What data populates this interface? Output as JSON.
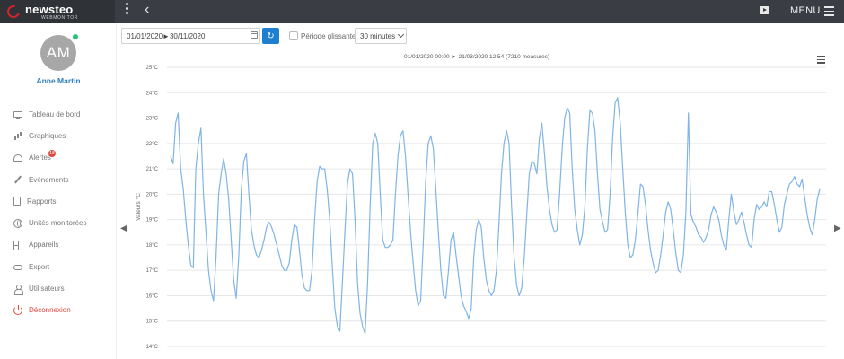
{
  "topbar": {
    "logo_main": "newsteo",
    "logo_sub": "WEBMONITOR",
    "menu_label": "MENU"
  },
  "user": {
    "initials": "AM",
    "name": "Anne Martin",
    "status_color": "#27c27a"
  },
  "sidebar": {
    "items": [
      {
        "label": "Tableau de bord",
        "icon": "monitor-icon"
      },
      {
        "label": "Graphiques",
        "icon": "bar-chart-icon"
      },
      {
        "label": "Alertes",
        "icon": "bell-icon",
        "badge": "18"
      },
      {
        "label": "Evénements",
        "icon": "pen-icon"
      },
      {
        "label": "Rapports",
        "icon": "document-icon"
      },
      {
        "label": "Unités monitorées",
        "icon": "globe-icon"
      },
      {
        "label": "Appareils",
        "icon": "grid-icon"
      },
      {
        "label": "Export",
        "icon": "cloud-upload-icon"
      },
      {
        "label": "Utilisateurs",
        "icon": "user-icon"
      },
      {
        "label": "Déconnexion",
        "icon": "power-icon"
      }
    ]
  },
  "toolbar": {
    "date_range": "01/01/2020►30/11/2020",
    "rolling_label": "Période glissante",
    "interval_selected": "30 minutes"
  },
  "colors": {
    "accent": "#1e7fd1",
    "line": "#7fb4e6",
    "logout": "#e0483e"
  },
  "chart_data": {
    "type": "line",
    "subtitle": "01/01/2020 00:00 ► 21/03/2020 12:54 (7210 measures)",
    "ylabel": "Valeurs °C",
    "ylim": [
      14,
      25
    ],
    "yticks": [
      "14°C",
      "15°C",
      "16°C",
      "17°C",
      "18°C",
      "19°C",
      "20°C",
      "21°C",
      "22°C",
      "23°C",
      "24°C",
      "25°C"
    ],
    "grid": true,
    "series": [
      {
        "name": "",
        "values": [
          21.5,
          21.2,
          22.8,
          23.2,
          21.0,
          20.2,
          19.0,
          18.0,
          17.2,
          17.1,
          21.0,
          22.0,
          22.6,
          20.0,
          18.5,
          17.0,
          16.2,
          15.8,
          17.5,
          20.0,
          20.8,
          21.4,
          20.8,
          19.8,
          18.2,
          16.6,
          15.9,
          17.6,
          20.2,
          21.3,
          21.6,
          20.0,
          18.6,
          18.0,
          17.6,
          17.5,
          17.8,
          18.2,
          18.7,
          18.9,
          18.7,
          18.4,
          18.0,
          17.6,
          17.2,
          17.0,
          17.0,
          17.3,
          18.2,
          18.8,
          18.7,
          17.8,
          16.8,
          16.3,
          16.2,
          16.2,
          17.0,
          19.0,
          20.5,
          21.1,
          21.0,
          21.0,
          20.2,
          19.0,
          17.2,
          15.5,
          14.8,
          14.6,
          16.5,
          18.5,
          20.4,
          21.0,
          20.8,
          19.0,
          16.5,
          15.3,
          14.8,
          14.5,
          16.5,
          19.5,
          22.0,
          22.4,
          22.0,
          20.0,
          18.2,
          17.9,
          17.9,
          18.0,
          18.2,
          20.0,
          21.5,
          22.3,
          22.5,
          21.5,
          20.0,
          18.5,
          17.3,
          16.2,
          15.6,
          15.8,
          18.0,
          20.5,
          22.0,
          22.3,
          21.8,
          20.2,
          18.5,
          17.0,
          16.0,
          15.9,
          17.0,
          18.2,
          18.5,
          17.6,
          16.8,
          16.0,
          15.6,
          15.4,
          15.1,
          15.5,
          17.5,
          18.6,
          19.0,
          18.7,
          17.5,
          16.6,
          16.2,
          16.0,
          16.2,
          17.0,
          18.8,
          20.8,
          22.0,
          22.5,
          22.0,
          19.5,
          17.5,
          16.4,
          16.0,
          16.3,
          17.5,
          19.2,
          20.8,
          21.3,
          21.2,
          20.8,
          22.2,
          22.8,
          21.6,
          20.3,
          19.4,
          18.8,
          18.5,
          18.6,
          20.0,
          21.8,
          23.0,
          23.4,
          23.2,
          21.0,
          19.4,
          18.6,
          18.0,
          18.4,
          19.5,
          21.8,
          23.3,
          23.2,
          22.5,
          20.8,
          19.4,
          18.9,
          18.5,
          18.6,
          20.0,
          22.2,
          23.6,
          23.8,
          22.8,
          21.0,
          19.3,
          18.0,
          17.5,
          17.6,
          18.2,
          19.2,
          20.4,
          20.3,
          19.6,
          18.6,
          17.8,
          17.3,
          16.9,
          17.0,
          17.6,
          18.4,
          19.3,
          19.7,
          19.4,
          18.6,
          17.7,
          17.0,
          16.9,
          17.6,
          19.3,
          23.2,
          19.2,
          18.9,
          18.7,
          18.4,
          18.3,
          18.1,
          18.3,
          18.6,
          19.2,
          19.5,
          19.3,
          19.0,
          18.4,
          18.0,
          17.8,
          19.0,
          20.0,
          19.3,
          18.8,
          19.0,
          19.3,
          18.9,
          18.4,
          18.0,
          17.9,
          19.0,
          19.6,
          19.4,
          19.5,
          19.7,
          19.5,
          20.1,
          20.1,
          19.6,
          19.0,
          18.5,
          18.7,
          19.6,
          20.0,
          20.4,
          20.5,
          20.7,
          20.4,
          20.3,
          20.6,
          19.9,
          19.2,
          18.7,
          18.4,
          19.0,
          19.8,
          20.2
        ]
      }
    ]
  }
}
